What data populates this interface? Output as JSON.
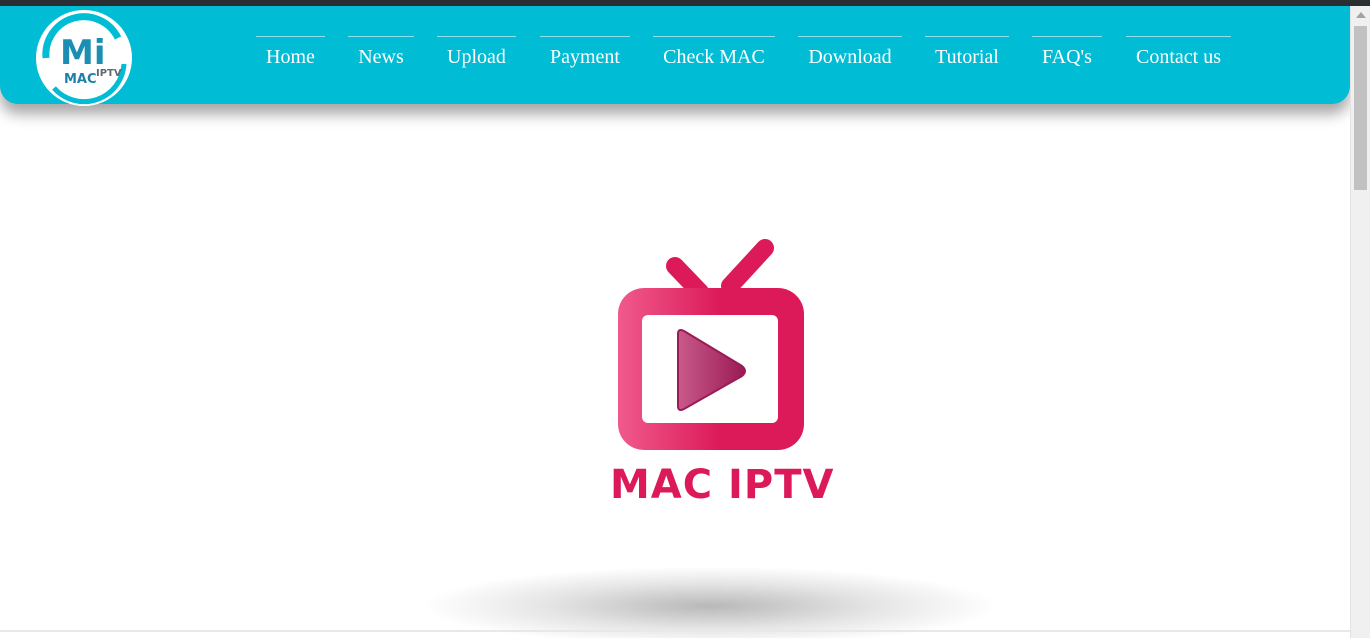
{
  "header": {
    "logo": {
      "mark": "Mi",
      "line1": "MAC",
      "line2": "IPTV"
    },
    "nav": [
      {
        "label": "Home"
      },
      {
        "label": "News"
      },
      {
        "label": "Upload"
      },
      {
        "label": "Payment"
      },
      {
        "label": "Check MAC"
      },
      {
        "label": "Download"
      },
      {
        "label": "Tutorial"
      },
      {
        "label": "FAQ's"
      },
      {
        "label": "Contact us"
      }
    ],
    "color": "#00bcd4"
  },
  "hero": {
    "brand_text": "MAC IPTV",
    "icon": "tv-play-icon",
    "color": "#dc1a5a"
  }
}
